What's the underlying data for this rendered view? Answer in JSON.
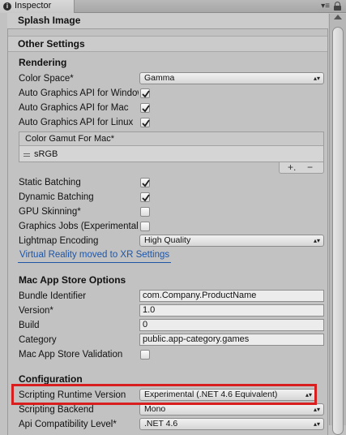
{
  "tab": {
    "title": "Inspector",
    "menu_glyph": "▾≡"
  },
  "headers": {
    "splash": "Splash Image",
    "other": "Other Settings"
  },
  "rendering": {
    "title": "Rendering",
    "color_space": {
      "label": "Color Space*",
      "value": "Gamma"
    },
    "api_win": {
      "label": "Auto Graphics API for Windows",
      "checked": true
    },
    "api_mac": {
      "label": "Auto Graphics API for Mac",
      "checked": true
    },
    "api_linux": {
      "label": "Auto Graphics API for Linux",
      "checked": true
    },
    "gamut": {
      "title": "Color Gamut For Mac*",
      "item": "sRGB",
      "plus": "+.",
      "minus": "−"
    },
    "static_batching": {
      "label": "Static Batching",
      "checked": true
    },
    "dynamic_batching": {
      "label": "Dynamic Batching",
      "checked": true
    },
    "gpu_skinning": {
      "label": "GPU Skinning*",
      "checked": false
    },
    "graphics_jobs": {
      "label": "Graphics Jobs (Experimental)",
      "checked": false
    },
    "lightmap": {
      "label": "Lightmap Encoding",
      "value": "High Quality"
    },
    "vr_link": "Virtual Reality moved to XR Settings"
  },
  "mac_store": {
    "title": "Mac App Store Options",
    "bundle_id": {
      "label": "Bundle Identifier",
      "value": "com.Company.ProductName"
    },
    "version": {
      "label": "Version*",
      "value": "1.0"
    },
    "build": {
      "label": "Build",
      "value": "0"
    },
    "category": {
      "label": "Category",
      "value": "public.app-category.games"
    },
    "validation": {
      "label": "Mac App Store Validation",
      "checked": false
    }
  },
  "configuration": {
    "title": "Configuration",
    "runtime": {
      "label": "Scripting Runtime Version",
      "value": "Experimental (.NET 4.6 Equivalent)"
    },
    "backend": {
      "label": "Scripting Backend",
      "value": "Mono"
    },
    "api_level": {
      "label": "Api Compatibility Level*",
      "value": ".NET 4.6"
    }
  }
}
